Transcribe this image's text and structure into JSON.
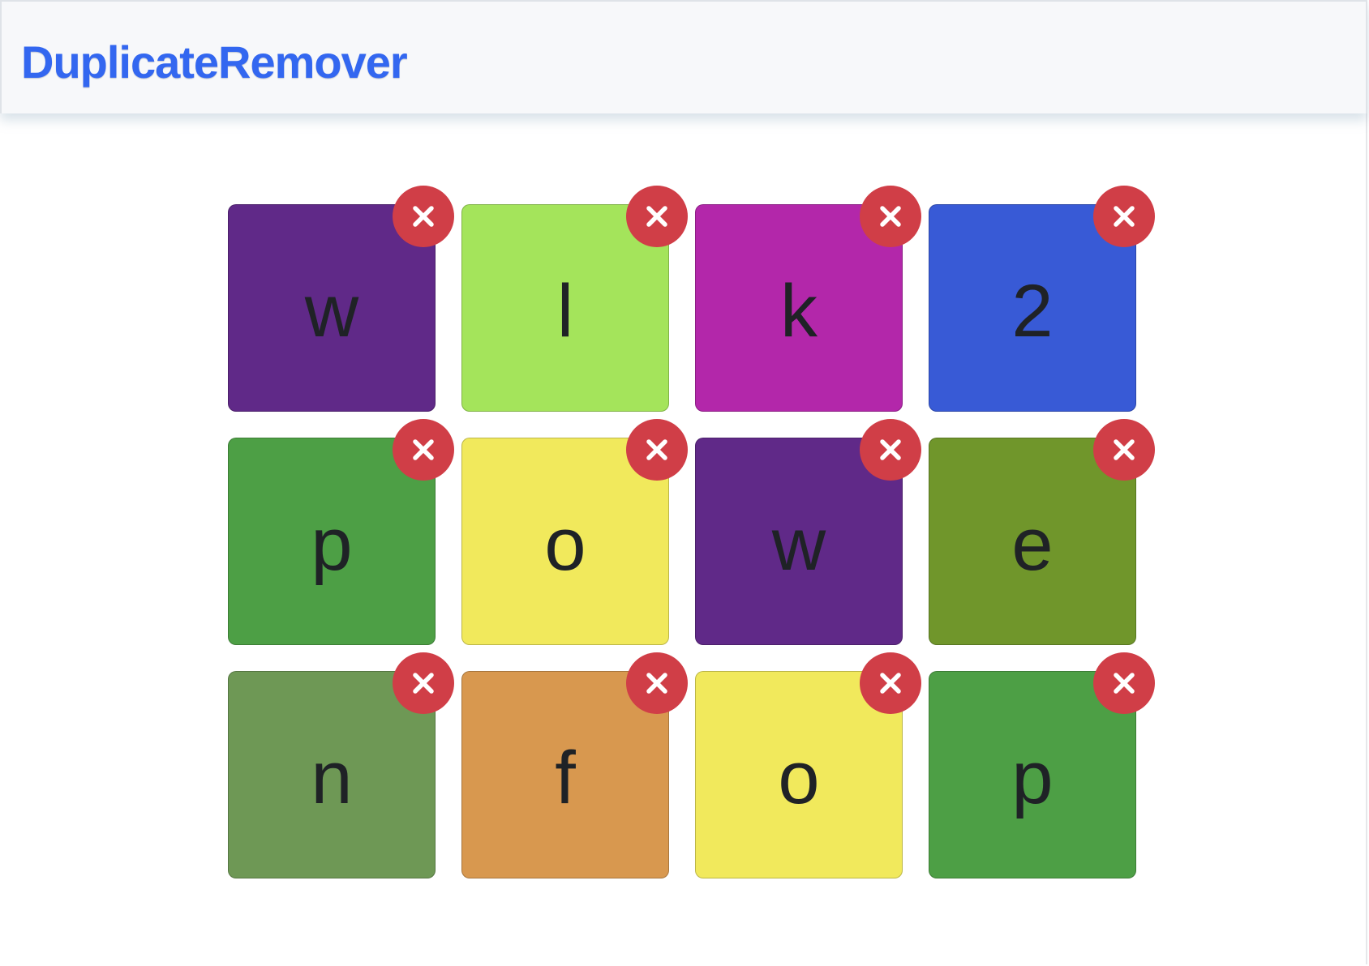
{
  "navbar": {
    "brand": "DuplicateRemover"
  },
  "tiles": [
    {
      "letter": "w",
      "color": "#602988"
    },
    {
      "letter": "l",
      "color": "#a4e45b"
    },
    {
      "letter": "k",
      "color": "#b327aa"
    },
    {
      "letter": "2",
      "color": "#385ad6"
    },
    {
      "letter": "p",
      "color": "#4d9f45"
    },
    {
      "letter": "o",
      "color": "#f1e95c"
    },
    {
      "letter": "w",
      "color": "#602988"
    },
    {
      "letter": "e",
      "color": "#70962b"
    },
    {
      "letter": "n",
      "color": "#6e9855"
    },
    {
      "letter": "f",
      "color": "#d8984f"
    },
    {
      "letter": "o",
      "color": "#f1e95c"
    },
    {
      "letter": "p",
      "color": "#4d9f45"
    }
  ],
  "remove_button": {
    "icon": "close-icon",
    "color": "#d03e47"
  }
}
